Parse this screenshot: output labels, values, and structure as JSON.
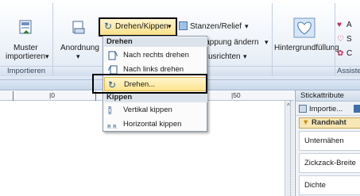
{
  "ribbon": {
    "import_button": {
      "line1": "Muster",
      "line2": "importieren",
      "arrow": "▾"
    },
    "import_group_label": "Importieren",
    "arrange_button": {
      "label": "Anordnung",
      "arrow": "▾"
    },
    "rotate_flip_button": {
      "label": "Drehen/Kippen",
      "arrow": "▾"
    },
    "stamp_relief_button": {
      "label": "Stanzen/Relief",
      "arrow": "▾"
    },
    "overlap_button": {
      "label": "lappung ändern",
      "arrow": "▾"
    },
    "align_button": {
      "label": "usrichten",
      "arrow": "▾"
    },
    "background_fill_button": {
      "label": "Hintergrundfüllung"
    },
    "assistant_group_label": "Assister",
    "right_edge_items": [
      "A",
      "S",
      "C"
    ]
  },
  "menu": {
    "header_rotate": "Drehen",
    "rotate_right": "Nach rechts drehen",
    "rotate_left": "Nach links drehen",
    "rotate_dialog": "Drehen...",
    "header_flip": "Kippen",
    "flip_vertical": "Vertikal kippen",
    "flip_horizontal": "Horizontal kippen"
  },
  "ruler": {
    "labels": [
      "|0",
      "|50"
    ]
  },
  "panel": {
    "title": "Stickattribute",
    "toolbar_label": "Importie...",
    "section": "Randnaht",
    "properties": [
      "Unternähen",
      "Zickzack-Breite",
      "Dichte"
    ]
  },
  "colors": {
    "highlight": "#fde48e",
    "accent": "#e3b440",
    "ribbon_bg": "#eaf0f8"
  }
}
